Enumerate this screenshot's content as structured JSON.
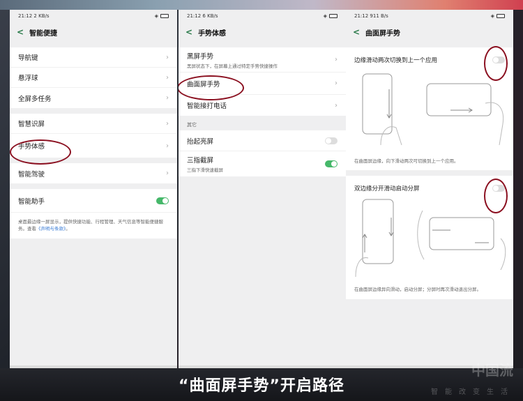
{
  "caption": "“曲面屏手势”开启路径",
  "watermark": "中国流",
  "watermark_sub": "智能改变生活",
  "screen1": {
    "status": {
      "time": "21:12",
      "speed": "2 KB/s"
    },
    "title": "智能便捷",
    "items_group1": [
      "导航键",
      "悬浮球",
      "全屏多任务"
    ],
    "items_group2": [
      "智慧识屏",
      "手势体感"
    ],
    "items_group3": [
      "智能驾驶"
    ],
    "assistant": {
      "label": "智能助手",
      "toggle": "on"
    },
    "desc_prefix": "桌面最边缘一屏显示，提供快捷功能、行程管理、天气信息等智能便捷服务。查看",
    "desc_link": "《声明与条款》",
    "desc_suffix": "。"
  },
  "screen2": {
    "status": {
      "time": "21:12",
      "speed": "6 KB/s"
    },
    "title": "手势体感",
    "items": [
      {
        "label": "黑屏手势",
        "sub": "黑屏状态下，在屏幕上通过特定手势快捷操作"
      },
      {
        "label": "曲面屏手势",
        "sub": ""
      },
      {
        "label": "智能接打电话",
        "sub": ""
      }
    ],
    "section_label": "其它",
    "other": [
      {
        "label": "抬起亮屏",
        "sub": "",
        "toggle": "off"
      },
      {
        "label": "三指截屏",
        "sub": "三指下滑快速截屏",
        "toggle": "on"
      }
    ]
  },
  "screen3": {
    "status": {
      "time": "21:12",
      "speed": "911 B/s"
    },
    "title": "曲面屏手势",
    "card1": {
      "title": "边缘滑动两次切换到上一个应用",
      "toggle": "off",
      "desc": "在曲面屏边缘，向下滑动两次可切换到上一个应用。"
    },
    "card2": {
      "title": "双边缘分开滑动启动分屏",
      "toggle": "off",
      "desc": "在曲面屏边缘异向滑动，启动分屏；分屏时再次滑动退出分屏。"
    }
  }
}
